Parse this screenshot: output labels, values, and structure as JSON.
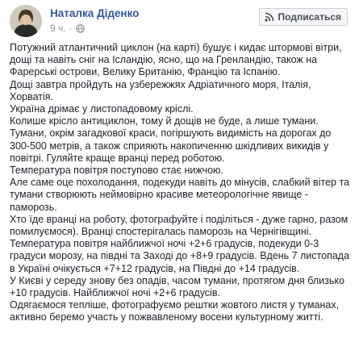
{
  "post": {
    "author": "Наталка Діденко",
    "time": "9 ч.",
    "subscribe_label": "Подписаться",
    "paragraphs": [
      "Потужний атлантичний циклон (на карті) бушує і кидає штормові вітри, дощі та навіть сніг на Ісландію, ясно, що на Гренландію, також на Фарерські острови, Велику Британію, Францію та Іспанію.",
      "Дощі завтра пройдуть на узбережжях Адріатичного моря, Італія, Хорватія.",
      "Україна дрімає у листопадовому кріслі.",
      "Колише крісло антициклон, тому й дощів не буде, а лише тумани.",
      "Тумани, окрім загадкової краси, погіршують видимість на дорогах до 300-500 метрів, а також сприяють накопиченню шкідливих викидів у повітрі. Гуляйте краще вранці перед роботою.",
      "Температура повітря поступово стає нижчою.",
      "Але саме оце похолодання, подекуди навіть до мінусів, слабкий вітер та тумани створюють неймовірно красиве метеорологічне явище - паморозь.",
      "Хто їде вранці на роботу, фотографуйте і поділіться - дуже гарно, разом помилуємося). Вранці спостерігалась паморозь на Чернігівщині.",
      "Температура повітря найближчої ночі +2+6 градусів, подекуди 0-3 градуси морозу, на півдні та Заході до +8+9 градусів. Вдень 7 листопада в Україні очікується +7+12 градусів, на Півдні до +14 градусів.",
      "У Києві у середу знову без опадів, часом тумани, протягом дня близько +10 градусів. Найближчої ночі +2+6 градусів.",
      "Одягаємося тепліше, фотографуємо рештки жовтого листя у туманах, активно беремо участь у пожвавленому восени культурному житті."
    ]
  }
}
